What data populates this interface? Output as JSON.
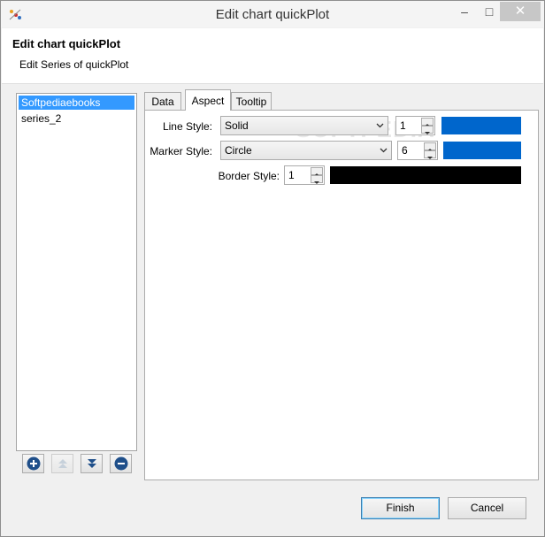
{
  "window": {
    "title": "Edit chart quickPlot",
    "minimize_symbol": "–",
    "maximize_symbol": "□",
    "close_symbol": "✕"
  },
  "header": {
    "title": "Edit chart quickPlot",
    "subtitle": "Edit Series of quickPlot"
  },
  "series_list": {
    "items": [
      "Softpediaebooks",
      "series_2"
    ],
    "selected_index": 0
  },
  "list_buttons": {
    "icons": [
      "add-icon",
      "move-up-icon",
      "move-down-icon",
      "remove-icon"
    ]
  },
  "tabs": [
    {
      "label": "Data"
    },
    {
      "label": "Aspect"
    },
    {
      "label": "Tooltip"
    }
  ],
  "active_tab": "Aspect",
  "aspect": {
    "line_style": {
      "label": "Line Style:",
      "value": "Solid",
      "width": "1",
      "color": "#0066cc"
    },
    "marker_style": {
      "label": "Marker Style:",
      "value": "Circle",
      "size": "6",
      "color": "#0066cc"
    },
    "border_style": {
      "label": "Border Style:",
      "width": "1",
      "color": "#000000"
    }
  },
  "watermark": "SOFTPEDIA",
  "footer": {
    "finish_label": "Finish",
    "cancel_label": "Cancel"
  }
}
